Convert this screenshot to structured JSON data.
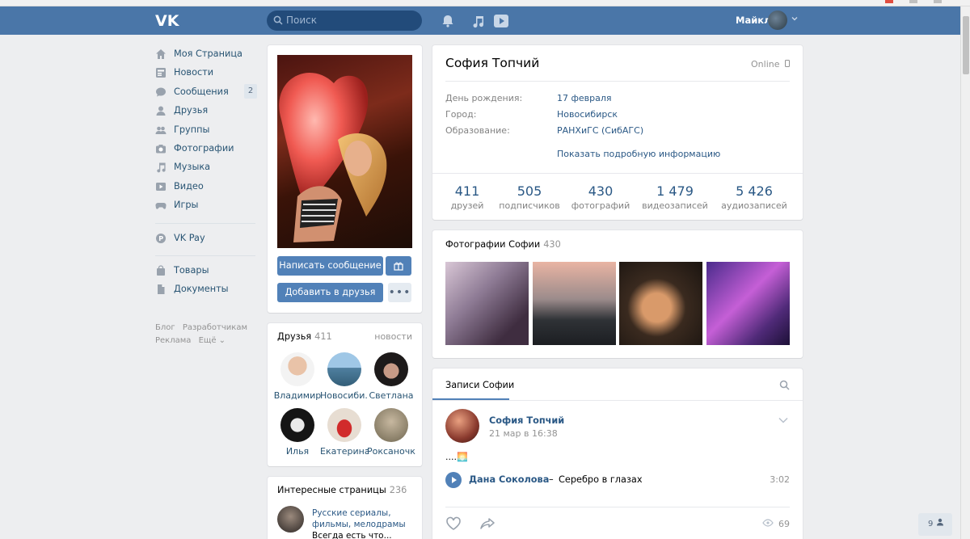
{
  "header": {
    "search_placeholder": "Поиск",
    "user_name": "Майкл"
  },
  "nav": {
    "items": [
      {
        "label": "Моя Страница"
      },
      {
        "label": "Новости"
      },
      {
        "label": "Сообщения",
        "badge": "2"
      },
      {
        "label": "Друзья"
      },
      {
        "label": "Группы"
      },
      {
        "label": "Фотографии"
      },
      {
        "label": "Музыка"
      },
      {
        "label": "Видео"
      },
      {
        "label": "Игры"
      }
    ],
    "vkpay": "VK Pay",
    "extra": [
      {
        "label": "Товары"
      },
      {
        "label": "Документы"
      }
    ],
    "footer": [
      "Блог",
      "Разработчикам",
      "Реклама",
      "Ещё ⌄"
    ]
  },
  "avatar_card": {
    "message_button": "Написать сообщение",
    "add_friend_button": "Добавить в друзья"
  },
  "friends": {
    "title": "Друзья",
    "count": "411",
    "link": "новости",
    "items": [
      {
        "name": "Владимир"
      },
      {
        "name": "Новосиби..."
      },
      {
        "name": "Светлана"
      },
      {
        "name": "Илья"
      },
      {
        "name": "Екатерина"
      },
      {
        "name": "Роксаночка"
      }
    ]
  },
  "interesting": {
    "title": "Интересные страницы",
    "count": "236",
    "item_text_1": "Русские сериалы,",
    "item_text_2": "фильмы, мелодрамы",
    "item_text_3": "Всегда есть что..."
  },
  "profile": {
    "name": "София Топчий",
    "status": "Online",
    "rows": [
      {
        "label": "День рождения:",
        "value": "17 февраля"
      },
      {
        "label": "Город:",
        "value": "Новосибирск"
      },
      {
        "label": "Образование:",
        "value": "РАНХиГС (СибАГС)"
      }
    ],
    "show_more": "Показать подробную информацию",
    "counters": [
      {
        "num": "411",
        "label": "друзей"
      },
      {
        "num": "505",
        "label": "подписчиков"
      },
      {
        "num": "430",
        "label": "фотографий"
      },
      {
        "num": "1 479",
        "label": "видеозаписей"
      },
      {
        "num": "5 426",
        "label": "аудиозаписей"
      }
    ]
  },
  "photos": {
    "title": "Фотографии Софии",
    "count": "430"
  },
  "wall": {
    "tab": "Записи Софии",
    "post": {
      "author": "София Топчий",
      "date": "21 мар в 16:38",
      "text": "....🌅",
      "audio_artist": "Дана Соколова",
      "audio_dash": "–",
      "audio_title": "Серебро в глазах",
      "audio_duration": "3:02",
      "views": "69"
    }
  },
  "chat_counter": "9",
  "colors": {
    "header": "#4a76a8",
    "link": "#2a5885",
    "button": "#5181b8",
    "background": "#edeef0"
  }
}
